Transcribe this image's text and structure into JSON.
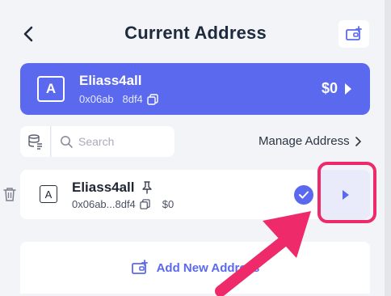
{
  "header": {
    "title": "Current Address",
    "back_icon": "chevron-left-icon",
    "wallet_icon": "wallet-add-icon"
  },
  "current_account": {
    "avatar_letter": "A",
    "name": "Eliass4all",
    "address": "0x06ab   8df4",
    "balance": "$0"
  },
  "toolbar": {
    "search_placeholder": "Search",
    "manage_label": "Manage Address"
  },
  "account_list": [
    {
      "avatar_letter": "A",
      "name": "Eliass4all",
      "address": "0x06ab...8df4",
      "balance": "$0",
      "selected": true
    }
  ],
  "add_button": {
    "label": "Add New Address"
  },
  "colors": {
    "accent": "#5b69ee",
    "highlight": "#ee2a6b",
    "background": "#f3f4f7"
  }
}
